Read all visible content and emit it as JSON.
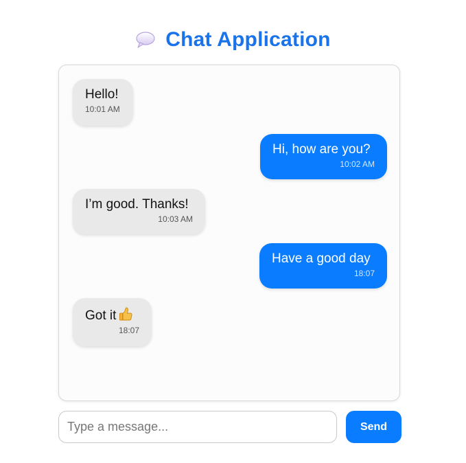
{
  "header": {
    "icon": "speech-bubble-icon",
    "title": "Chat Application",
    "accent_color": "#1a73e8"
  },
  "messages": [
    {
      "side": "received",
      "text": "Hello!",
      "time": "10:01 AM"
    },
    {
      "side": "sent",
      "text": "Hi, how are you?",
      "time": "10:02 AM"
    },
    {
      "side": "received",
      "text": "I’m good. Thanks!",
      "time": "10:03 AM"
    },
    {
      "side": "sent",
      "text": "Have a good day",
      "time": "18:07"
    },
    {
      "side": "received",
      "text": "Got it",
      "emoji": "thumbs-up-icon",
      "time": "18:07"
    }
  ],
  "composer": {
    "placeholder": "Type a message...",
    "value": "",
    "send_label": "Send"
  },
  "colors": {
    "sent_bubble": "#0a7cff",
    "received_bubble": "#e9e9e9"
  }
}
